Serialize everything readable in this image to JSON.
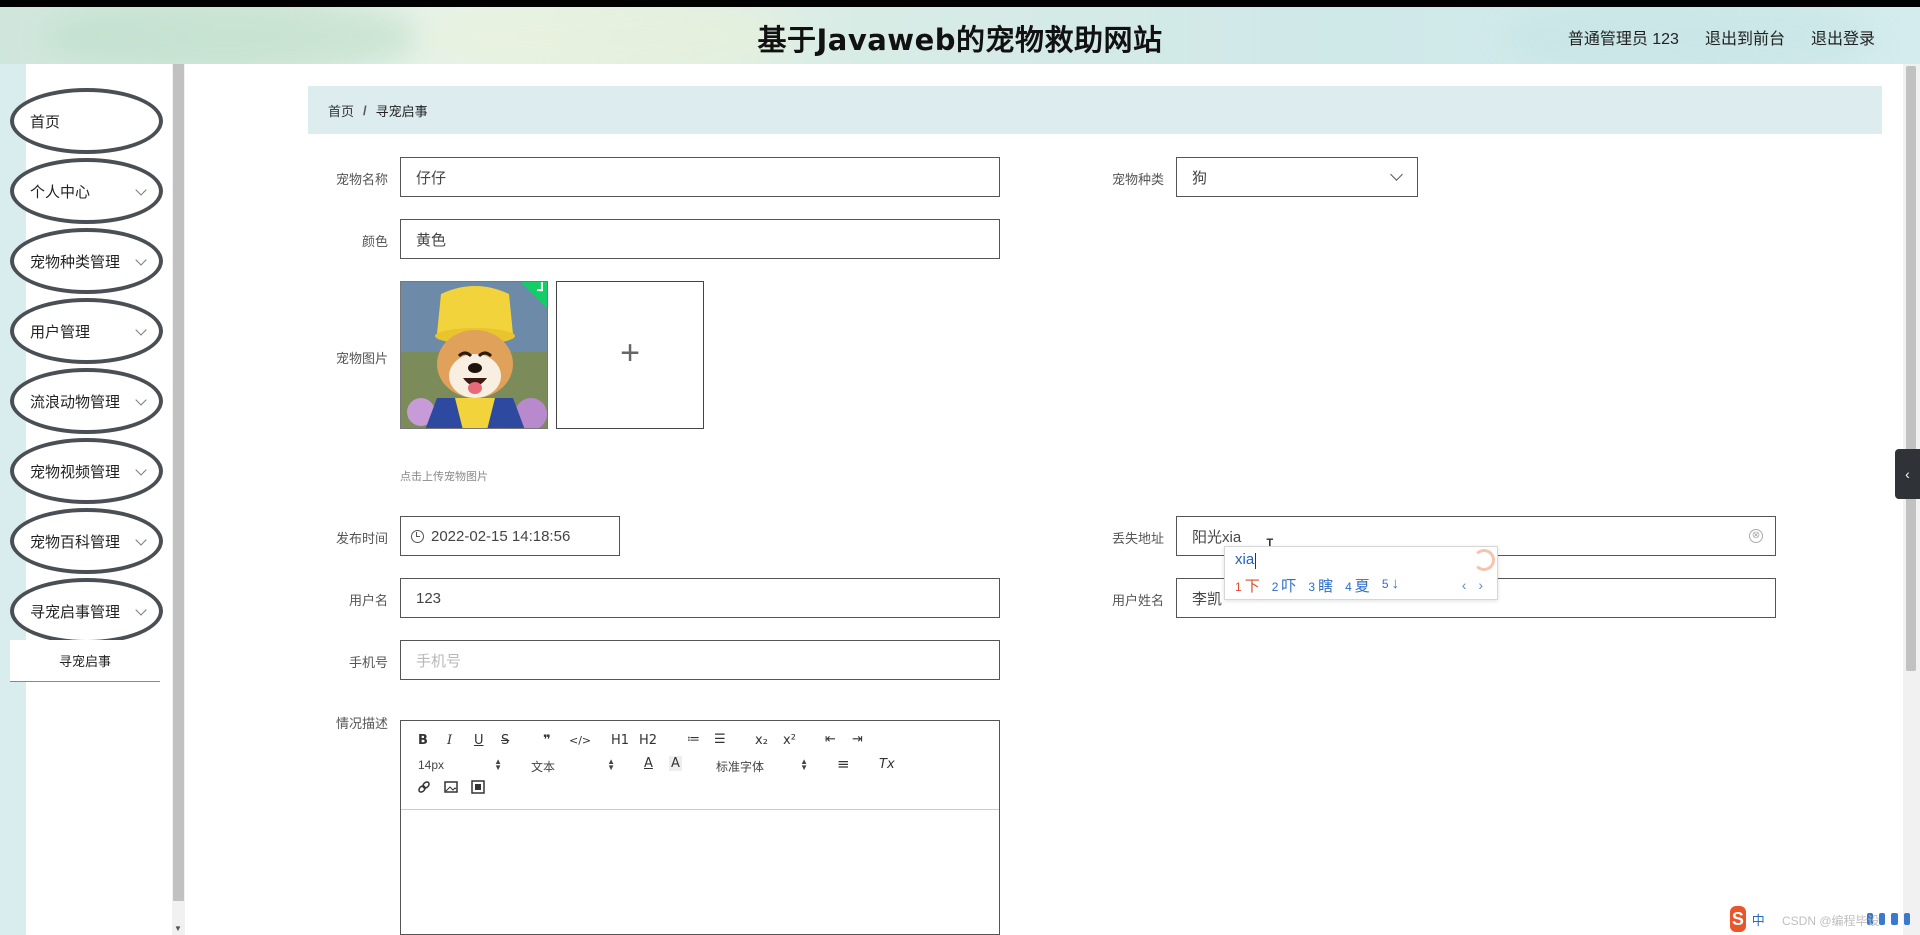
{
  "header": {
    "title": "基于Javaweb的宠物救助网站",
    "user_label": "普通管理员 123",
    "front_link": "退出到前台",
    "logout_link": "退出登录"
  },
  "sidebar": {
    "items": [
      {
        "label": "首页",
        "has_arrow": false
      },
      {
        "label": "个人中心",
        "has_arrow": true
      },
      {
        "label": "宠物种类管理",
        "has_arrow": true
      },
      {
        "label": "用户管理",
        "has_arrow": true
      },
      {
        "label": "流浪动物管理",
        "has_arrow": true
      },
      {
        "label": "宠物视频管理",
        "has_arrow": true
      },
      {
        "label": "宠物百科管理",
        "has_arrow": true
      },
      {
        "label": "寻宠启事管理",
        "has_arrow": true
      }
    ],
    "submenu_active": "寻宠启事"
  },
  "breadcrumb": {
    "home": "首页",
    "separator": "/",
    "current": "寻宠启事"
  },
  "form": {
    "pet_name": {
      "label": "宠物名称",
      "value": "仔仔"
    },
    "pet_type": {
      "label": "宠物种类",
      "value": "狗"
    },
    "color": {
      "label": "颜色",
      "value": "黄色"
    },
    "pet_image": {
      "label": "宠物图片",
      "hint": "点击上传宠物图片",
      "upload_icon": "+"
    },
    "publish_time": {
      "label": "发布时间",
      "value": "2022-02-15 14:18:56"
    },
    "lost_address": {
      "label": "丢失地址",
      "value": "阳光xia",
      "clear_icon": "⊗"
    },
    "username": {
      "label": "用户名",
      "value": "123"
    },
    "real_name": {
      "label": "用户姓名",
      "value": "李凯"
    },
    "phone": {
      "label": "手机号",
      "placeholder": "手机号"
    },
    "description": {
      "label": "情况描述"
    }
  },
  "editor": {
    "toolbar_row1": [
      "B",
      "I",
      "U",
      "S",
      "❞",
      "</>",
      "H1",
      "H2",
      "≔",
      "☰",
      "x₂",
      "x²",
      "⇤",
      "⇥"
    ],
    "font_size": "14px",
    "block_type": "文本",
    "font_family": "标准字体",
    "color_icon": "A",
    "bg_icon": "A",
    "align_icon": "≡",
    "clear_format_icon": "Tx"
  },
  "ime": {
    "composition": "xia",
    "candidates": [
      {
        "num": "1",
        "text": "下"
      },
      {
        "num": "2",
        "text": "吓"
      },
      {
        "num": "3",
        "text": "瞎"
      },
      {
        "num": "4",
        "text": "夏"
      },
      {
        "num": "5",
        "text": "↓"
      }
    ],
    "pager": "‹ ›"
  },
  "tray": {
    "logo": "S",
    "ime_mode": "中",
    "watermark": "CSDN @编程毕设"
  },
  "colors": {
    "header_bg": "#d5ecee",
    "breadcrumb_bg": "#dcecef",
    "menu_border": "#4a4f55",
    "upload_success": "#13ce66",
    "ime_highlight": "#e04b2b",
    "ime_text": "#2d6ec7"
  }
}
